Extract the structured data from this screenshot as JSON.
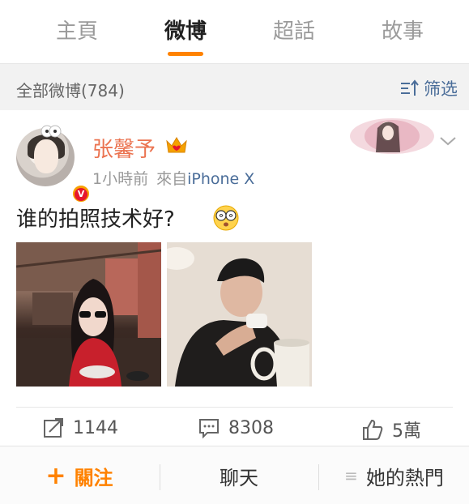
{
  "tabs": [
    {
      "label": "主頁",
      "active": false
    },
    {
      "label": "微博",
      "active": true
    },
    {
      "label": "超話",
      "active": false
    },
    {
      "label": "故事",
      "active": false
    }
  ],
  "filter": {
    "count_label": "全部微博(784)",
    "filter_label": "筛选",
    "filter_icon": "sort-filter-icon"
  },
  "post": {
    "username": "张馨予",
    "badge_icon": "crown-vip-icon",
    "verified_icon": "verified-v-icon",
    "time": "1小時前",
    "from_prefix": "來自",
    "source": "iPhone X",
    "text": "谁的拍照技术好?",
    "emoji_icon": "dizzy-face-emoji",
    "images": [
      {
        "name": "photo-woman-sunglasses"
      },
      {
        "name": "photo-man-drinking"
      }
    ],
    "actions": {
      "repost_count": "1144",
      "comment_count": "8308",
      "like_count": "5萬"
    }
  },
  "bottom_bar": {
    "follow_label": "關注",
    "chat_label": "聊天",
    "hot_label": "她的熱門"
  },
  "colors": {
    "accent": "#ff8200",
    "username": "#eb7350",
    "link": "#4a6d99"
  }
}
